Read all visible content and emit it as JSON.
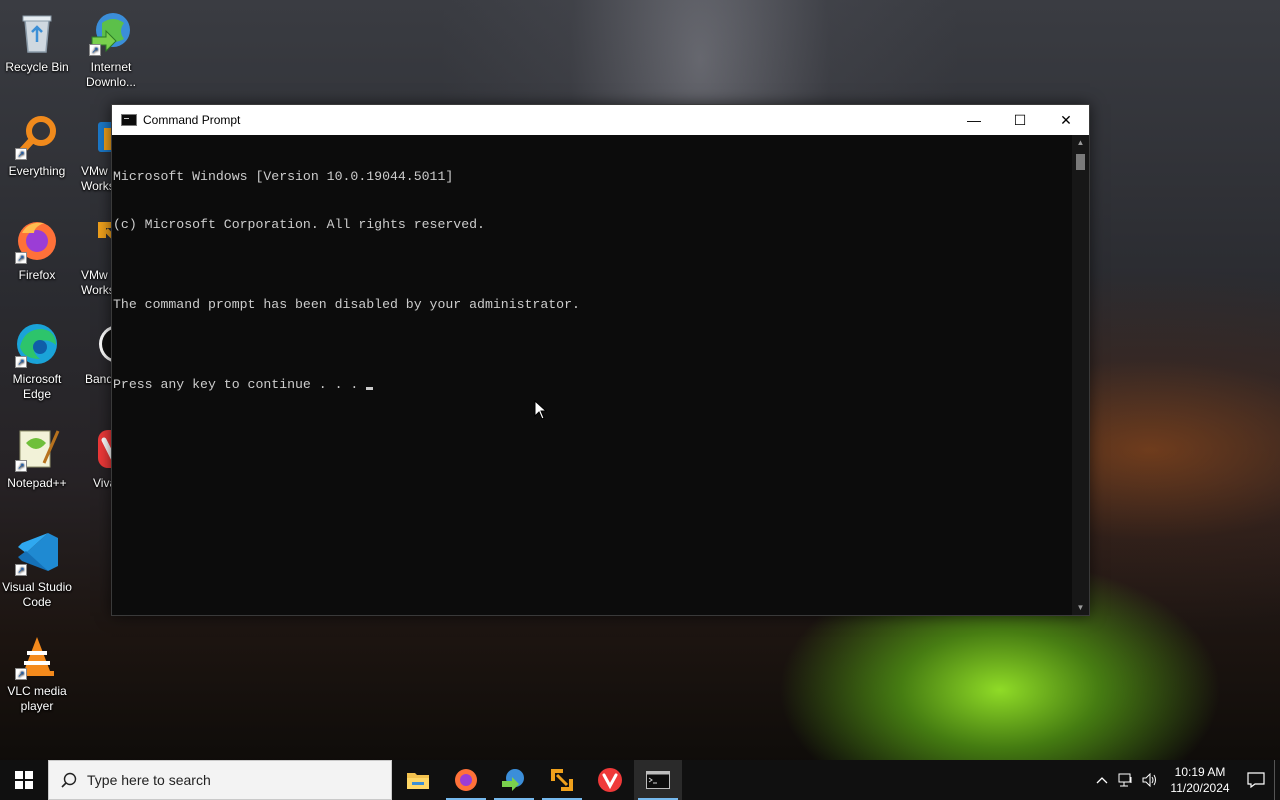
{
  "desktop": {
    "icons": [
      {
        "label": "Recycle Bin"
      },
      {
        "label": "Internet Downlo..."
      },
      {
        "label": "Everything"
      },
      {
        "label": "VMw Works"
      },
      {
        "label": "Firefox"
      },
      {
        "label": "VMw Works"
      },
      {
        "label": "Microsoft Edge"
      },
      {
        "label": "Band"
      },
      {
        "label": "Notepad++"
      },
      {
        "label": "Viva"
      },
      {
        "label": "Visual Studio Code"
      },
      {
        "label": "VLC media player"
      }
    ]
  },
  "cmd": {
    "title": "Command Prompt",
    "lines": [
      "Microsoft Windows [Version 10.0.19044.5011]",
      "(c) Microsoft Corporation. All rights reserved.",
      "",
      "The command prompt has been disabled by your administrator.",
      "",
      "Press any key to continue . . . "
    ],
    "controls": {
      "minimize": "—",
      "maximize": "☐",
      "close": "✕"
    }
  },
  "taskbar": {
    "search_placeholder": "Type here to search",
    "apps": [
      "file-explorer",
      "firefox",
      "internet-download-manager",
      "vmware",
      "vivaldi",
      "command-prompt"
    ],
    "active_app": "command-prompt",
    "clock": {
      "time": "10:19 AM",
      "date": "11/20/2024"
    }
  },
  "colors": {
    "console_bg": "#0c0c0c",
    "console_text": "#cccccc",
    "taskbar_bg": "#101010",
    "active_indicator": "#76b9ed"
  }
}
